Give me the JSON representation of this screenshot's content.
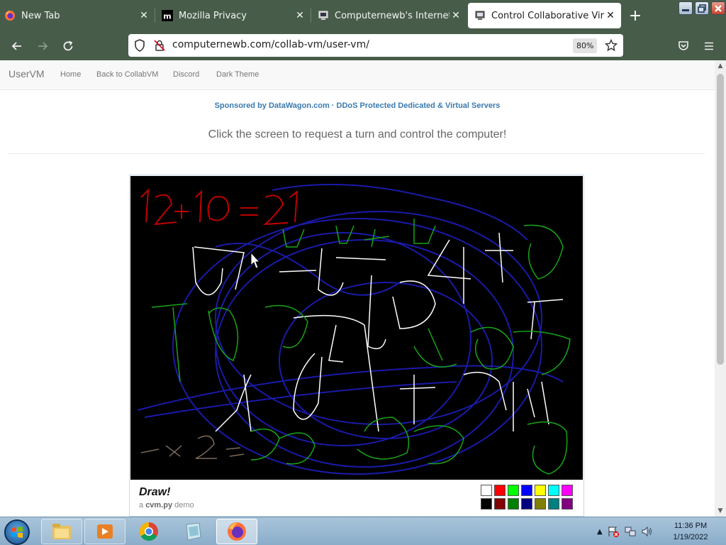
{
  "browser": {
    "tabs": [
      {
        "title": "New Tab",
        "icon": "firefox-icon",
        "active": false
      },
      {
        "title": "Mozilla Privacy",
        "icon": "mozilla-m-icon",
        "active": false
      },
      {
        "title": "Computernewb's Internet Pub",
        "icon": "computernewb-icon",
        "active": false
      },
      {
        "title": "Control Collaborative Virtual M",
        "icon": "computernewb-icon",
        "active": true
      }
    ],
    "url": "computernewb.com/collab-vm/user-vm/",
    "zoom": "80%"
  },
  "site": {
    "brand": "UserVM",
    "nav_links": [
      "Home",
      "Back to CollabVM",
      "Discord",
      "Dark Theme"
    ],
    "sponsor": "Sponsored by DataWagon.com · DDoS Protected Dedicated & Virtual Servers",
    "instruction": "Click the screen to request a turn and control the computer!"
  },
  "vm": {
    "drawing_text": "12+10=21",
    "app_title": "Draw!",
    "sub_prefix": "a",
    "sub_name": "cvm.py",
    "sub_suffix": "demo",
    "palette": [
      "#ffffff",
      "#ff0000",
      "#00ff00",
      "#0000ff",
      "#ffff00",
      "#00ffff",
      "#ff00ff",
      "#000000",
      "#800000",
      "#008000",
      "#000080",
      "#808000",
      "#008080",
      "#800080"
    ]
  },
  "taskbar": {
    "time": "11:36 PM",
    "date": "1/19/2022"
  }
}
